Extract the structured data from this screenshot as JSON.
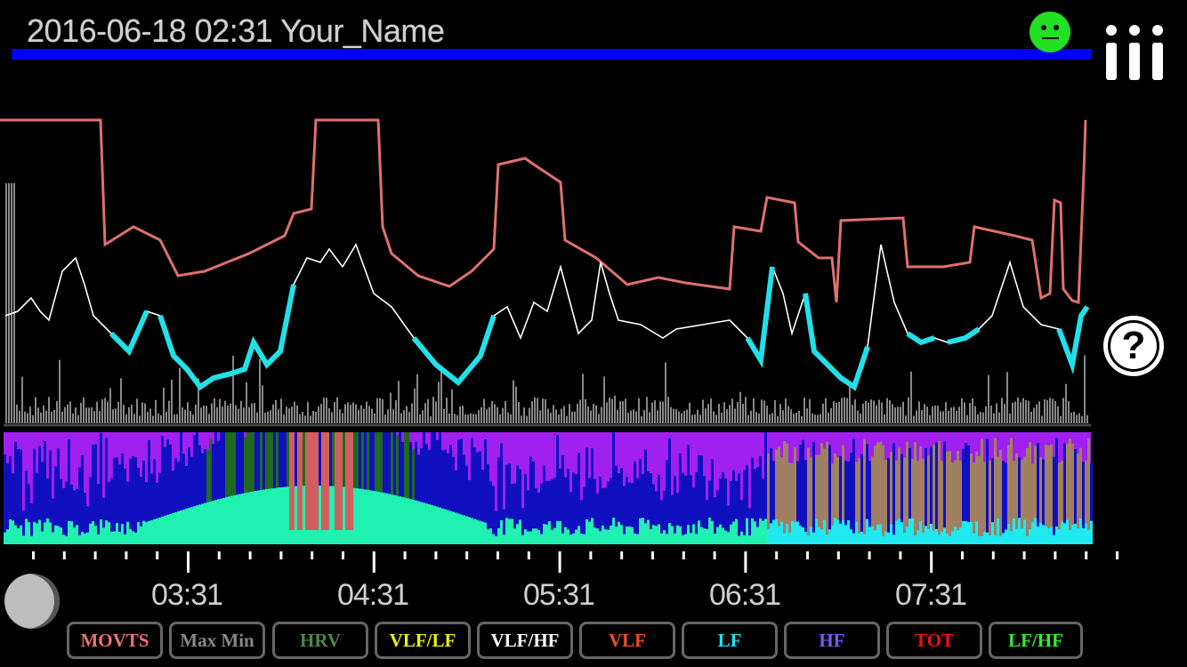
{
  "header": {
    "title": "2016-06-18 02:31 Your_Name",
    "status_icon": "smiley-neutral-icon",
    "status_color": "#22e022",
    "bar_color": "#0000ff"
  },
  "menu": {
    "icon": "menu-icon"
  },
  "help": {
    "label": "?",
    "icon": "help-icon"
  },
  "timeline": {
    "labels": [
      "03:31",
      "04:31",
      "05:31",
      "06:31",
      "07:31"
    ]
  },
  "colors": {
    "movts": "#e07070",
    "hrv_line": "#ffffff",
    "hrv_low": "#22e0e8",
    "activity": "#888888",
    "vlf": "#a020f0",
    "lf": "#1010c0",
    "hf": "#20f0b0",
    "tot": "#a08060"
  },
  "buttons": [
    {
      "label": "MOVTS",
      "color": "#f07070"
    },
    {
      "label": "Max Min",
      "color": "#888888"
    },
    {
      "label": "HRV",
      "color": "#4a8a4a"
    },
    {
      "label": "VLF/LF",
      "color": "#f0f000"
    },
    {
      "label": "VLF/HF",
      "color": "#ffffff"
    },
    {
      "label": "VLF",
      "color": "#f05020"
    },
    {
      "label": "LF",
      "color": "#20e0f0"
    },
    {
      "label": "HF",
      "color": "#7060f0"
    },
    {
      "label": "TOT",
      "color": "#f01010"
    },
    {
      "label": "LF/HF",
      "color": "#30f030"
    }
  ]
}
